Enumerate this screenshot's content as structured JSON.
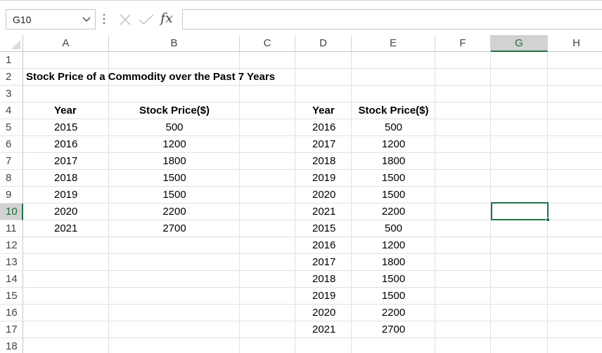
{
  "formula_bar": {
    "name_box": "G10",
    "formula": "",
    "fx_label": "fx"
  },
  "columns": [
    "A",
    "B",
    "C",
    "D",
    "E",
    "F",
    "G",
    "H"
  ],
  "rows": [
    "1",
    "2",
    "3",
    "4",
    "5",
    "6",
    "7",
    "8",
    "9",
    "10",
    "11",
    "12",
    "13",
    "14",
    "15",
    "16",
    "17",
    "18"
  ],
  "selection": {
    "column": "G",
    "row": "10"
  },
  "sheet": {
    "title": "Stock Price of a Commodity over the Past 7 Years",
    "table1": {
      "headers": [
        "Year",
        "Stock Price($)"
      ],
      "rows": [
        [
          "2015",
          "500"
        ],
        [
          "2016",
          "1200"
        ],
        [
          "2017",
          "1800"
        ],
        [
          "2018",
          "1500"
        ],
        [
          "2019",
          "1500"
        ],
        [
          "2020",
          "2200"
        ],
        [
          "2021",
          "2700"
        ]
      ]
    },
    "table2": {
      "headers": [
        "Year",
        "Stock Price($)"
      ],
      "rows": [
        [
          "2016",
          "500"
        ],
        [
          "2017",
          "1200"
        ],
        [
          "2018",
          "1800"
        ],
        [
          "2019",
          "1500"
        ],
        [
          "2020",
          "1500"
        ],
        [
          "2021",
          "2200"
        ],
        [
          "2015",
          "500"
        ],
        [
          "2016",
          "1200"
        ],
        [
          "2017",
          "1800"
        ],
        [
          "2018",
          "1500"
        ],
        [
          "2019",
          "1500"
        ],
        [
          "2020",
          "2200"
        ],
        [
          "2021",
          "2700"
        ]
      ]
    }
  },
  "colors": {
    "accent": "#217346",
    "gridline": "#e1e1e1",
    "header_selected": "#d2d2d2"
  }
}
